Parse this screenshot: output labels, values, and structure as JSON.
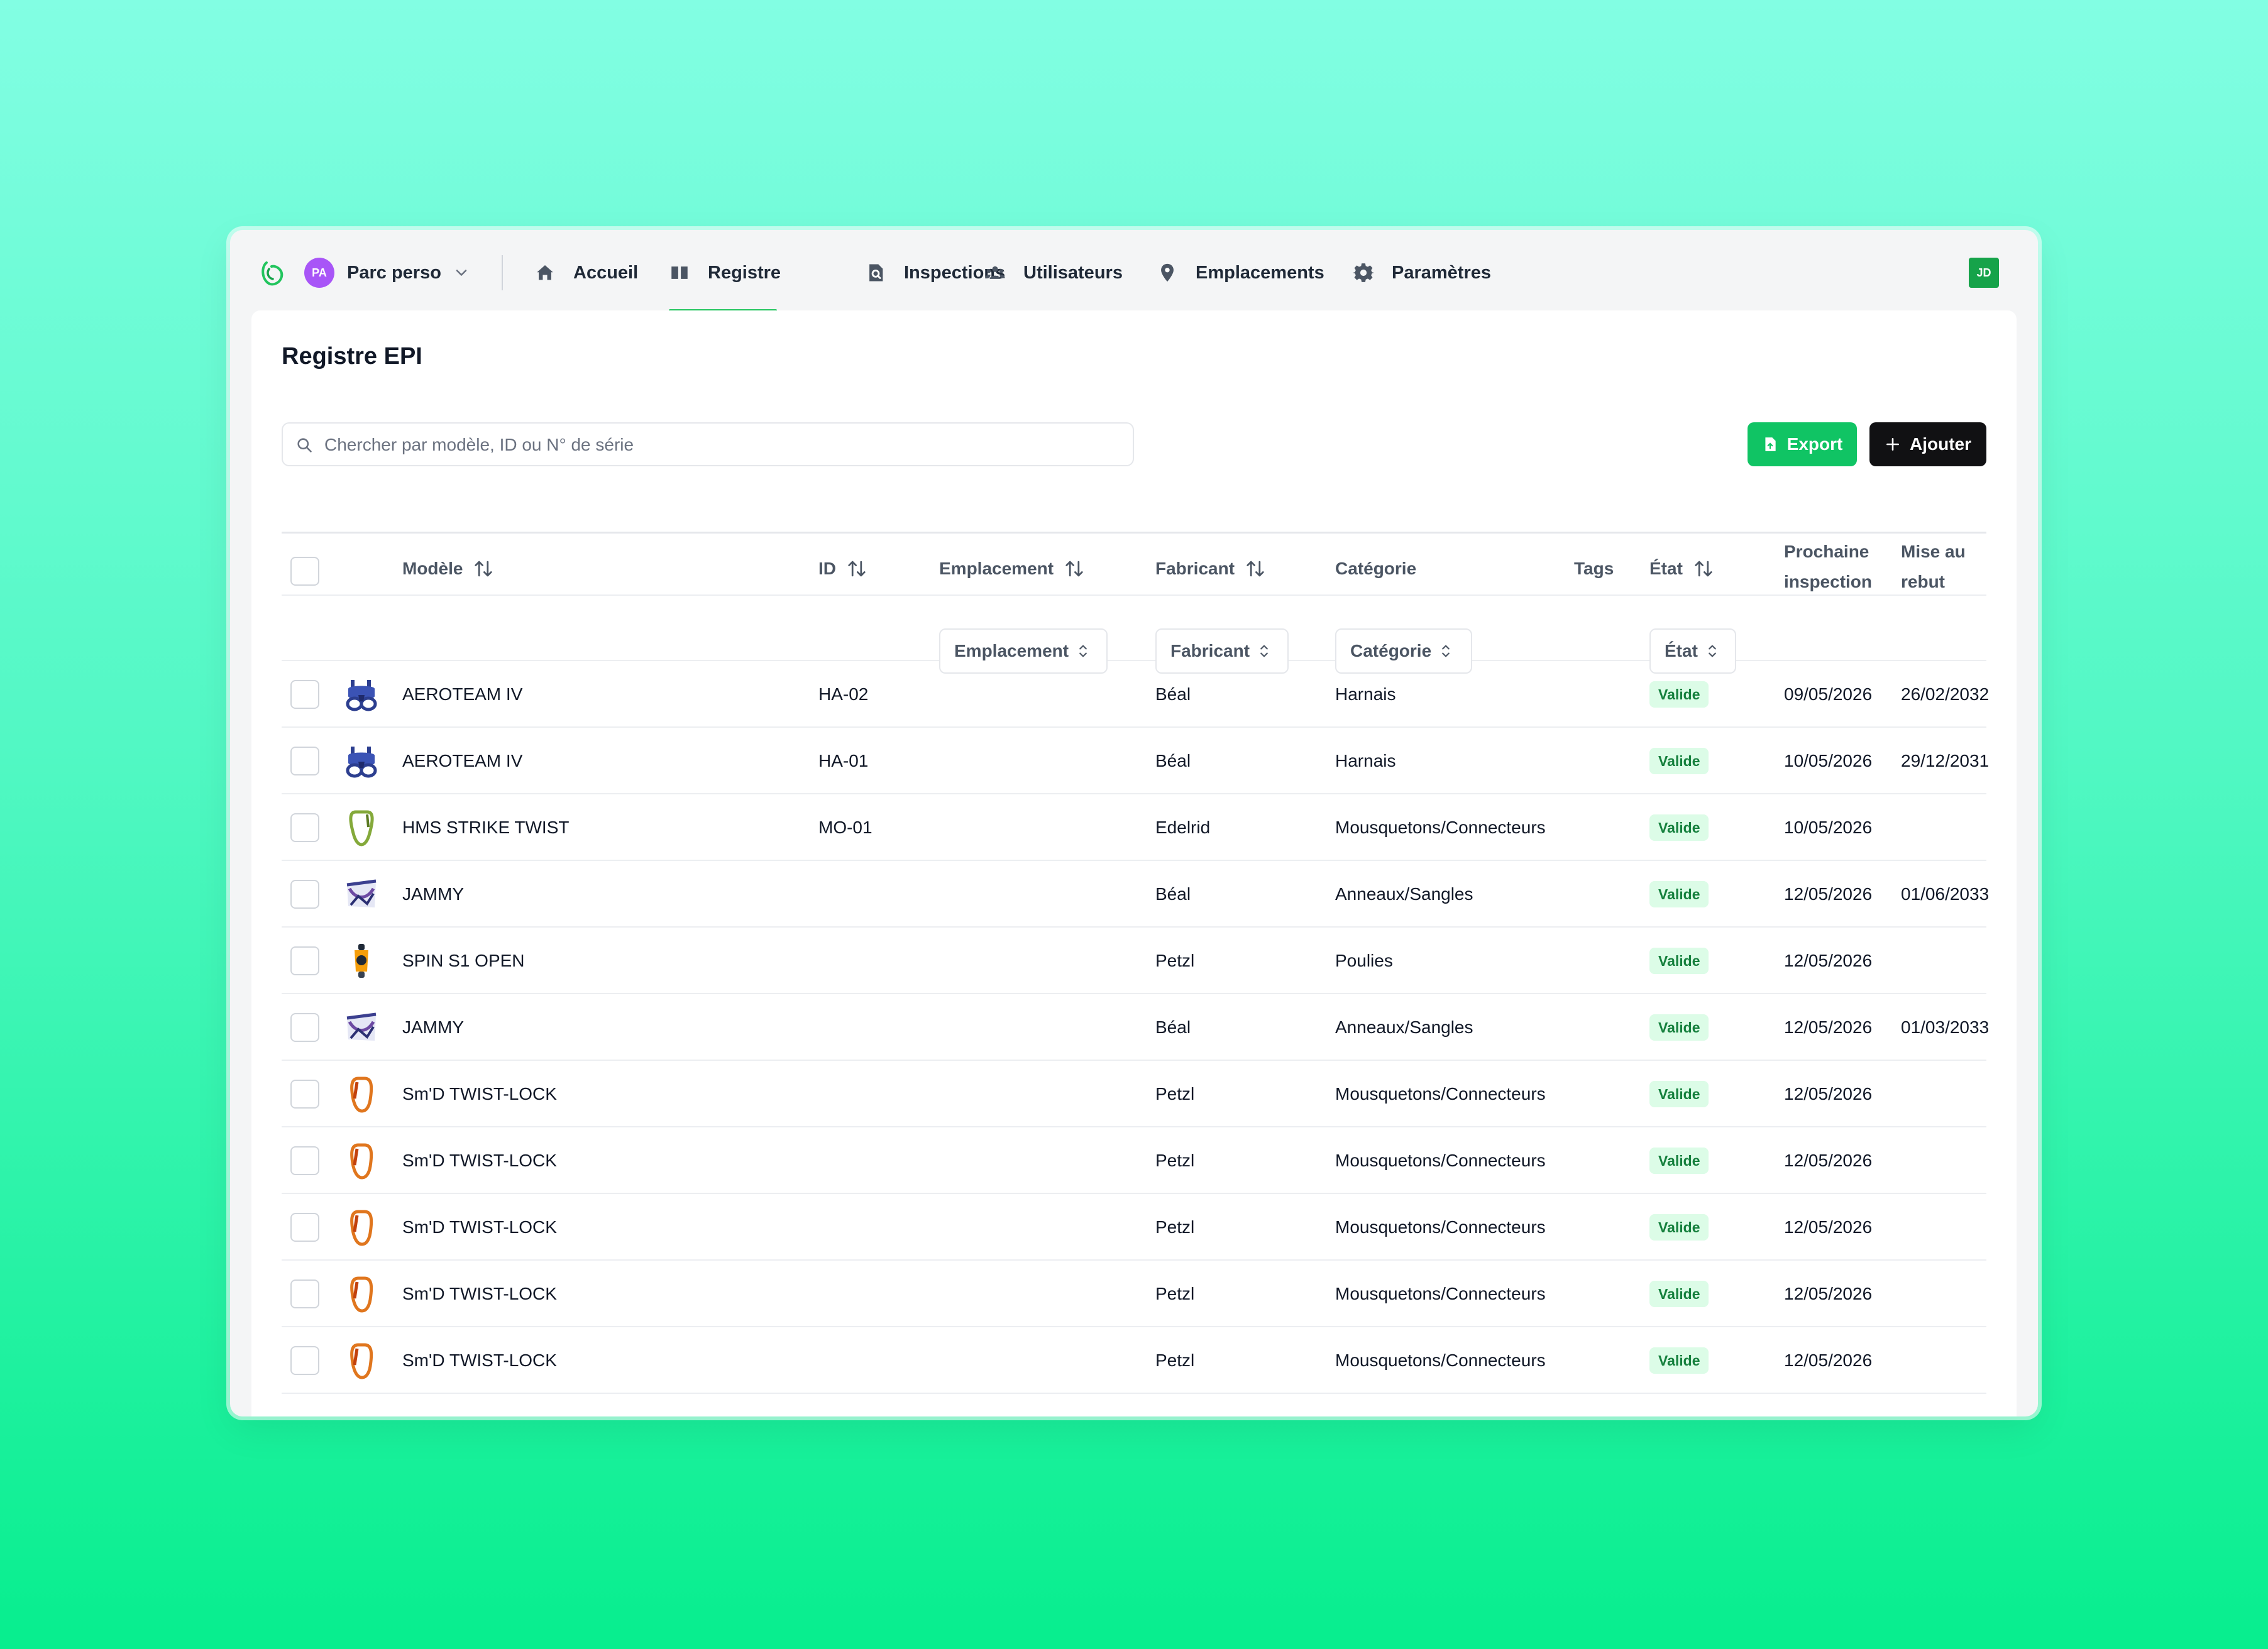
{
  "org": {
    "initials": "PA",
    "name": "Parc perso"
  },
  "nav": {
    "items": [
      {
        "label": "Accueil",
        "icon": "home-icon"
      },
      {
        "label": "Registre",
        "icon": "book-icon",
        "active": true
      },
      {
        "label": "Inspections",
        "icon": "inspection-search-icon"
      },
      {
        "label": "Utilisateurs",
        "icon": "users-icon"
      },
      {
        "label": "Emplacements",
        "icon": "map-pin-icon"
      },
      {
        "label": "Paramètres",
        "icon": "gear-icon"
      }
    ],
    "user_initials": "JD"
  },
  "colors": {
    "accent": "#22c55e",
    "export_button": "#10c464",
    "add_button": "#111113",
    "badge_bg": "#dcfce7",
    "badge_text": "#15803d"
  },
  "page": {
    "title": "Registre EPI",
    "search_placeholder": "Chercher par modèle, ID ou N° de série",
    "export_label": "Export",
    "add_label": "Ajouter"
  },
  "table": {
    "headers": {
      "model": "Modèle",
      "id": "ID",
      "location": "Emplacement",
      "manufacturer": "Fabricant",
      "category": "Catégorie",
      "tags": "Tags",
      "state": "État",
      "next_inspection_1": "Prochaine",
      "next_inspection_2": "inspection",
      "retire_1": "Mise au",
      "retire_2": "rebut"
    },
    "filters": {
      "location": "Emplacement",
      "manufacturer": "Fabricant",
      "category": "Catégorie",
      "state": "État"
    },
    "rows": [
      {
        "model": "AEROTEAM IV",
        "id": "HA-02",
        "location": "",
        "manufacturer": "Béal",
        "category": "Harnais",
        "tags": "",
        "state": "Valide",
        "next_inspection": "09/05/2026",
        "retire": "26/02/2032",
        "thumb": "harness"
      },
      {
        "model": "AEROTEAM IV",
        "id": "HA-01",
        "location": "",
        "manufacturer": "Béal",
        "category": "Harnais",
        "tags": "",
        "state": "Valide",
        "next_inspection": "10/05/2026",
        "retire": "29/12/2031",
        "thumb": "harness"
      },
      {
        "model": "HMS STRIKE TWIST",
        "id": "MO-01",
        "location": "",
        "manufacturer": "Edelrid",
        "category": "Mousquetons/Connecteurs",
        "tags": "",
        "state": "Valide",
        "next_inspection": "10/05/2026",
        "retire": "",
        "thumb": "carabiner-green"
      },
      {
        "model": "JAMMY",
        "id": "",
        "location": "",
        "manufacturer": "Béal",
        "category": "Anneaux/Sangles",
        "tags": "",
        "state": "Valide",
        "next_inspection": "12/05/2026",
        "retire": "01/06/2033",
        "thumb": "sling"
      },
      {
        "model": "SPIN S1 OPEN",
        "id": "",
        "location": "",
        "manufacturer": "Petzl",
        "category": "Poulies",
        "tags": "",
        "state": "Valide",
        "next_inspection": "12/05/2026",
        "retire": "",
        "thumb": "pulley"
      },
      {
        "model": "JAMMY",
        "id": "",
        "location": "",
        "manufacturer": "Béal",
        "category": "Anneaux/Sangles",
        "tags": "",
        "state": "Valide",
        "next_inspection": "12/05/2026",
        "retire": "01/03/2033",
        "thumb": "sling"
      },
      {
        "model": "Sm'D TWIST-LOCK",
        "id": "",
        "location": "",
        "manufacturer": "Petzl",
        "category": "Mousquetons/Connecteurs",
        "tags": "",
        "state": "Valide",
        "next_inspection": "12/05/2026",
        "retire": "",
        "thumb": "carabiner-orange"
      },
      {
        "model": "Sm'D TWIST-LOCK",
        "id": "",
        "location": "",
        "manufacturer": "Petzl",
        "category": "Mousquetons/Connecteurs",
        "tags": "",
        "state": "Valide",
        "next_inspection": "12/05/2026",
        "retire": "",
        "thumb": "carabiner-orange"
      },
      {
        "model": "Sm'D TWIST-LOCK",
        "id": "",
        "location": "",
        "manufacturer": "Petzl",
        "category": "Mousquetons/Connecteurs",
        "tags": "",
        "state": "Valide",
        "next_inspection": "12/05/2026",
        "retire": "",
        "thumb": "carabiner-orange"
      },
      {
        "model": "Sm'D TWIST-LOCK",
        "id": "",
        "location": "",
        "manufacturer": "Petzl",
        "category": "Mousquetons/Connecteurs",
        "tags": "",
        "state": "Valide",
        "next_inspection": "12/05/2026",
        "retire": "",
        "thumb": "carabiner-orange"
      },
      {
        "model": "Sm'D TWIST-LOCK",
        "id": "",
        "location": "",
        "manufacturer": "Petzl",
        "category": "Mousquetons/Connecteurs",
        "tags": "",
        "state": "Valide",
        "next_inspection": "12/05/2026",
        "retire": "",
        "thumb": "carabiner-orange"
      }
    ]
  }
}
